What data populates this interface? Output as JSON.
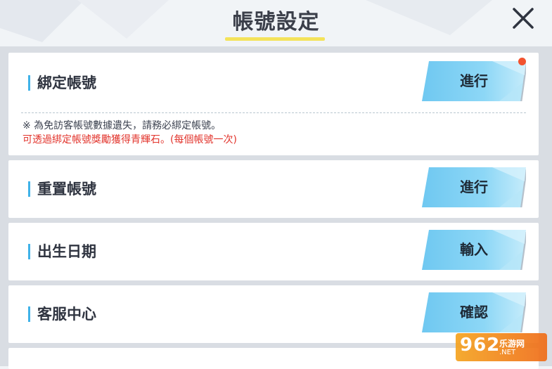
{
  "header": {
    "title": "帳號設定",
    "close_icon": "close-icon"
  },
  "rows": [
    {
      "label": "綁定帳號",
      "button_label": "進行",
      "has_badge": true,
      "note_line_1": "※ 為免訪客帳號數據遺失，請務必綁定帳號。",
      "note_line_2": "可透過綁定帳號獎勵獲得青輝石。(每個帳號一次)"
    },
    {
      "label": "重置帳號",
      "button_label": "進行"
    },
    {
      "label": "出生日期",
      "button_label": "輸入"
    },
    {
      "label": "客服中心",
      "button_label": "確認"
    }
  ],
  "colors": {
    "accent_bar": "#3fb2e8",
    "button_fill": "#7fd0f4",
    "title_underline": "#f4e35a",
    "note_warning": "#e2342c",
    "badge": "#f2532f"
  },
  "watermark": {
    "number": "962",
    "text": "乐游网",
    "url": ".NET"
  }
}
